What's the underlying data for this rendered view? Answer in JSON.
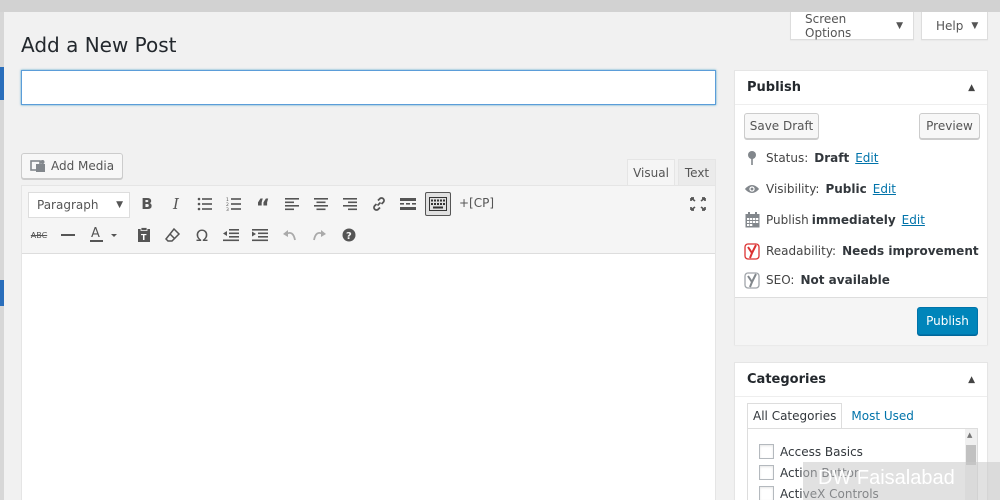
{
  "header": {
    "page_title": "Add a New Post",
    "screen_options_label": "Screen Options",
    "help_label": "Help"
  },
  "title_input": {
    "value": "",
    "placeholder": ""
  },
  "editor": {
    "add_media_label": "Add Media",
    "tabs": {
      "visual": "Visual",
      "text": "Text"
    },
    "format_select": "Paragraph",
    "cp_label": "+[CP]",
    "toolbar_row1_icons": [
      "bold-icon",
      "italic-icon",
      "bulleted-list-icon",
      "numbered-list-icon",
      "blockquote-icon",
      "align-left-icon",
      "align-center-icon",
      "align-right-icon",
      "insert-link-icon",
      "read-more-icon",
      "toolbar-toggle-icon",
      "fullscreen-icon"
    ],
    "toolbar_row2_icons": [
      "strikethrough-icon",
      "horizontal-line-icon",
      "text-color-icon",
      "paste-as-text-icon",
      "clear-formatting-icon",
      "special-character-icon",
      "outdent-icon",
      "indent-icon",
      "undo-icon",
      "redo-icon",
      "keyboard-shortcuts-icon"
    ]
  },
  "publish_box": {
    "title": "Publish",
    "save_draft_label": "Save Draft",
    "preview_label": "Preview",
    "status": {
      "label": "Status:",
      "value": "Draft",
      "edit": "Edit"
    },
    "visibility": {
      "label": "Visibility:",
      "value": "Public",
      "edit": "Edit"
    },
    "schedule": {
      "label": "Publish",
      "value": "immediately",
      "edit": "Edit"
    },
    "readability": {
      "label": "Readability:",
      "value": "Needs improvement"
    },
    "seo": {
      "label": "SEO:",
      "value": "Not available"
    },
    "publish_label": "Publish"
  },
  "categories_box": {
    "title": "Categories",
    "tab_all": "All Categories",
    "tab_most_used": "Most Used",
    "items": [
      "Access Basics",
      "Action Button",
      "ActiveX Controls"
    ]
  },
  "watermark": "DW Faisalabad",
  "colors": {
    "primary": "#0085ba",
    "link": "#0073aa",
    "yoast_red": "#dc3232"
  }
}
